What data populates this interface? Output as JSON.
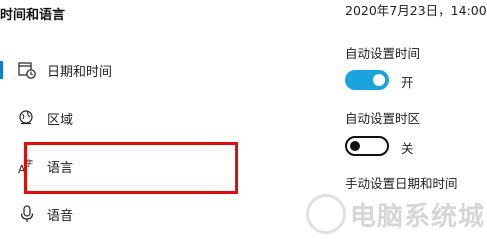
{
  "sidebar": {
    "title": "时间和语言",
    "items": [
      {
        "label": "日期和时间",
        "icon": "calendar-clock-icon",
        "active": true
      },
      {
        "label": "区域",
        "icon": "globe-icon",
        "active": false
      },
      {
        "label": "语言",
        "icon": "language-icon",
        "active": false
      },
      {
        "label": "语音",
        "icon": "microphone-icon",
        "active": false
      }
    ]
  },
  "main": {
    "datetime": "2020年7月23日，14:00",
    "auto_time": {
      "label": "自动设置时间",
      "state_text": "开",
      "on": true
    },
    "auto_timezone": {
      "label": "自动设置时区",
      "state_text": "关",
      "on": false
    },
    "manual_time_label": "手动设置日期和时间"
  },
  "colors": {
    "accent": "#1aa3dd",
    "active_indicator": "#0f7dc7",
    "highlight": "#e00d0d"
  },
  "watermark": {
    "text": "电脑系统城"
  }
}
